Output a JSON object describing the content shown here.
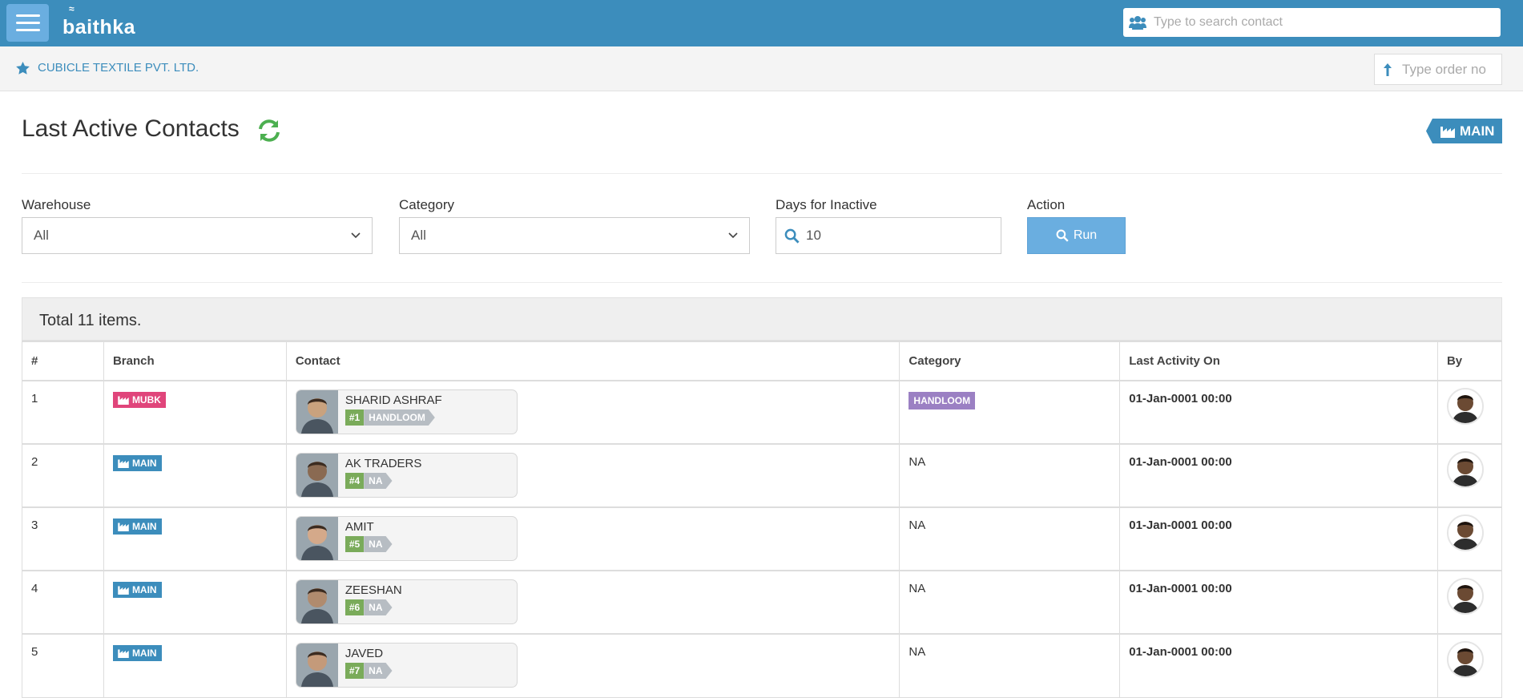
{
  "header": {
    "logo": "baithka",
    "search_placeholder": "Type to search contact",
    "brand_color": "#3c8dbc"
  },
  "companybar": {
    "company_name": "CUBICLE TEXTILE PVT. LTD.",
    "order_placeholder": "Type order no"
  },
  "page": {
    "title": "Last Active Contacts",
    "branch_badge": "MAIN"
  },
  "filters": {
    "warehouse_label": "Warehouse",
    "warehouse_value": "All",
    "category_label": "Category",
    "category_value": "All",
    "days_label": "Days for Inactive",
    "days_value": "10",
    "action_label": "Action",
    "run_label": "Run"
  },
  "table": {
    "total_text": "Total 11 items.",
    "columns": [
      "#",
      "Branch",
      "Contact",
      "Category",
      "Last Activity On",
      "By"
    ],
    "rows": [
      {
        "num": "1",
        "branch": "MUBK",
        "branch_color": "#e0457b",
        "contact": "SHARID ASHRAF",
        "contact_id": "#1",
        "contact_cat": "HANDLOOM",
        "category": "HANDLOOM",
        "category_is_badge": true,
        "activity": "01-Jan-0001 00:00"
      },
      {
        "num": "2",
        "branch": "MAIN",
        "branch_color": "#3c8dbc",
        "contact": "AK TRADERS",
        "contact_id": "#4",
        "contact_cat": "NA",
        "category": "NA",
        "category_is_badge": false,
        "activity": "01-Jan-0001 00:00"
      },
      {
        "num": "3",
        "branch": "MAIN",
        "branch_color": "#3c8dbc",
        "contact": "AMIT",
        "contact_id": "#5",
        "contact_cat": "NA",
        "category": "NA",
        "category_is_badge": false,
        "activity": "01-Jan-0001 00:00"
      },
      {
        "num": "4",
        "branch": "MAIN",
        "branch_color": "#3c8dbc",
        "contact": "ZEESHAN",
        "contact_id": "#6",
        "contact_cat": "NA",
        "category": "NA",
        "category_is_badge": false,
        "activity": "01-Jan-0001 00:00"
      },
      {
        "num": "5",
        "branch": "MAIN",
        "branch_color": "#3c8dbc",
        "contact": "JAVED",
        "contact_id": "#7",
        "contact_cat": "NA",
        "category": "NA",
        "category_is_badge": false,
        "activity": "01-Jan-0001 00:00"
      }
    ]
  }
}
